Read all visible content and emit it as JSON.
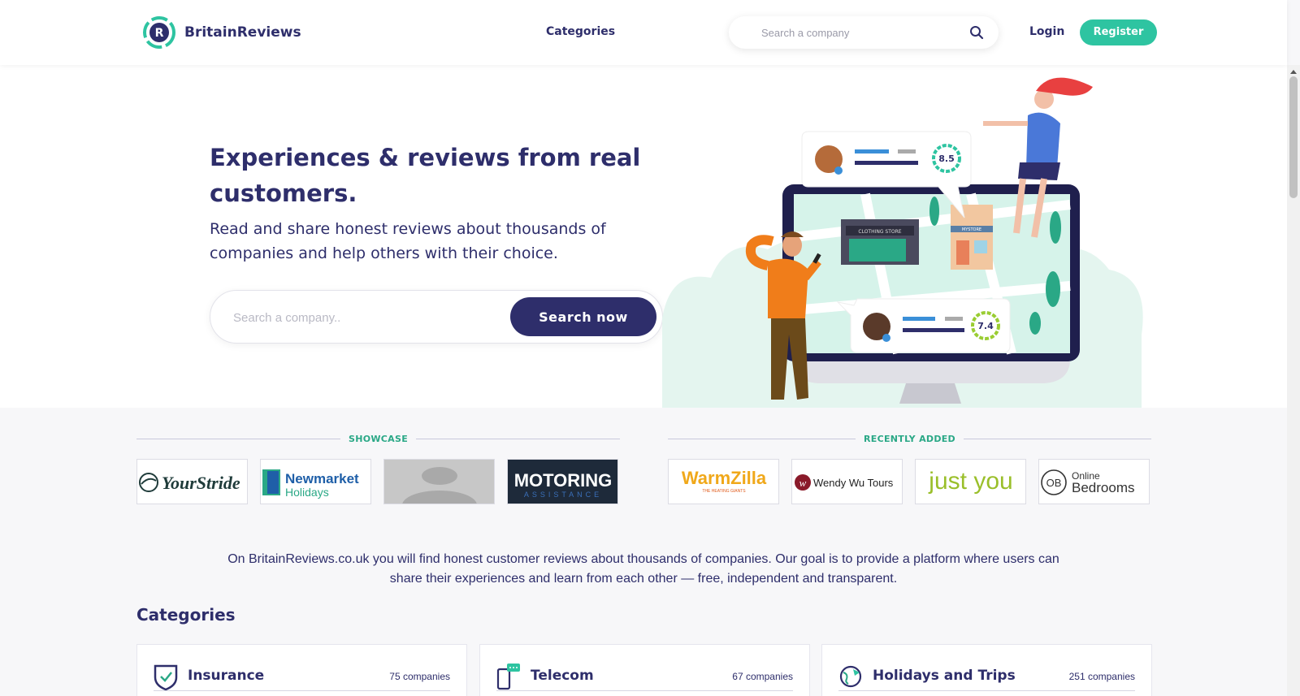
{
  "header": {
    "brand": "BritainReviews",
    "nav_categories": "Categories",
    "search_placeholder": "Search a company",
    "login": "Login",
    "register": "Register"
  },
  "hero": {
    "title": "Experiences & reviews from real customers.",
    "subtitle": "Read and share honest reviews about thousands of companies and help others with their choice.",
    "search_placeholder": "Search a company..",
    "search_button": "Search now",
    "score_1": "8.5",
    "score_2": "7.4",
    "store_sign_1": "CLOTHING STORE",
    "store_sign_2": "MYSTORE"
  },
  "showcase": {
    "label": "SHOWCASE",
    "logos": [
      {
        "name": "YourStride"
      },
      {
        "name": "Newmarket",
        "sub": "Holidays"
      },
      {
        "name": ""
      },
      {
        "name": "MOTORING",
        "sub": "ASSISTANCE"
      }
    ]
  },
  "recent": {
    "label": "RECENTLY ADDED",
    "logos": [
      {
        "name": "WarmZilla",
        "sub": "THE HEATING GIANTS"
      },
      {
        "name": "Wendy Wu Tours"
      },
      {
        "name": "just you"
      },
      {
        "name": "Online",
        "sub": "Bedrooms"
      }
    ]
  },
  "intro": "On BritainReviews.co.uk you will find honest customer reviews about thousands of companies. Our goal is to provide a platform where users can share their experiences and learn from each other — free, independent and transparent.",
  "categories": {
    "title": "Categories",
    "items": [
      {
        "name": "Insurance",
        "count": "75 companies",
        "icon": "shield-check-icon"
      },
      {
        "name": "Telecom",
        "count": "67 companies",
        "icon": "phone-message-icon"
      },
      {
        "name": "Holidays and Trips",
        "count": "251 companies",
        "icon": "globe-plane-icon"
      }
    ]
  },
  "colors": {
    "brand_navy": "#2e2e6b",
    "brand_green": "#2ec4a1",
    "background": "#f7f7f9"
  }
}
